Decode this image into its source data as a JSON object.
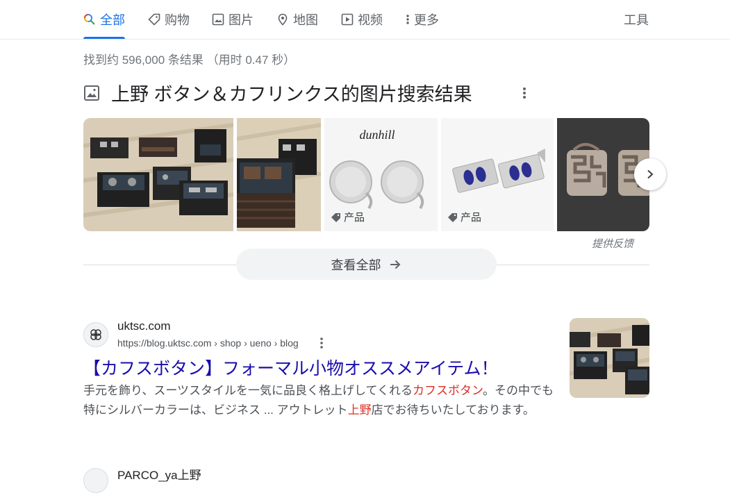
{
  "tabs": [
    {
      "label": "全部",
      "icon": "search-icon",
      "active": true
    },
    {
      "label": "购物",
      "icon": "tag-icon"
    },
    {
      "label": "图片",
      "icon": "image-icon"
    },
    {
      "label": "地图",
      "icon": "map-pin-icon"
    },
    {
      "label": "视频",
      "icon": "play-icon"
    },
    {
      "label": "更多",
      "icon": "more-vert-icon"
    }
  ],
  "tools_label": "工具",
  "stats": "找到约 596,000 条结果 （用时 0.47 秒）",
  "image_pack": {
    "title": "上野 ボタン＆カフリンクス的图片搜索结果",
    "product_label": "产品",
    "feedback": "提供反馈",
    "view_all": "查看全部",
    "thumb3_brand": "dunhill"
  },
  "result": {
    "site": "uktsc.com",
    "url": "https://blog.uktsc.com › shop › ueno › blog",
    "title": "【カフスボタン】フォーマル小物オススメアイテム！",
    "snippet_parts": {
      "p1": "手元を飾り、スーツスタイルを一気に品良く格上げしてくれる",
      "h1": "カフスボタン",
      "p2": "。その中でも特にシルバーカラーは、ビジネス ... アウトレット",
      "h2": "上野",
      "p3": "店でお待ちいたしております。"
    }
  },
  "next_result": {
    "site": "PARCO_ya上野"
  },
  "colors": {
    "accent": "#1a73e8",
    "link": "#1a0dab",
    "highlight": "#d93025"
  }
}
